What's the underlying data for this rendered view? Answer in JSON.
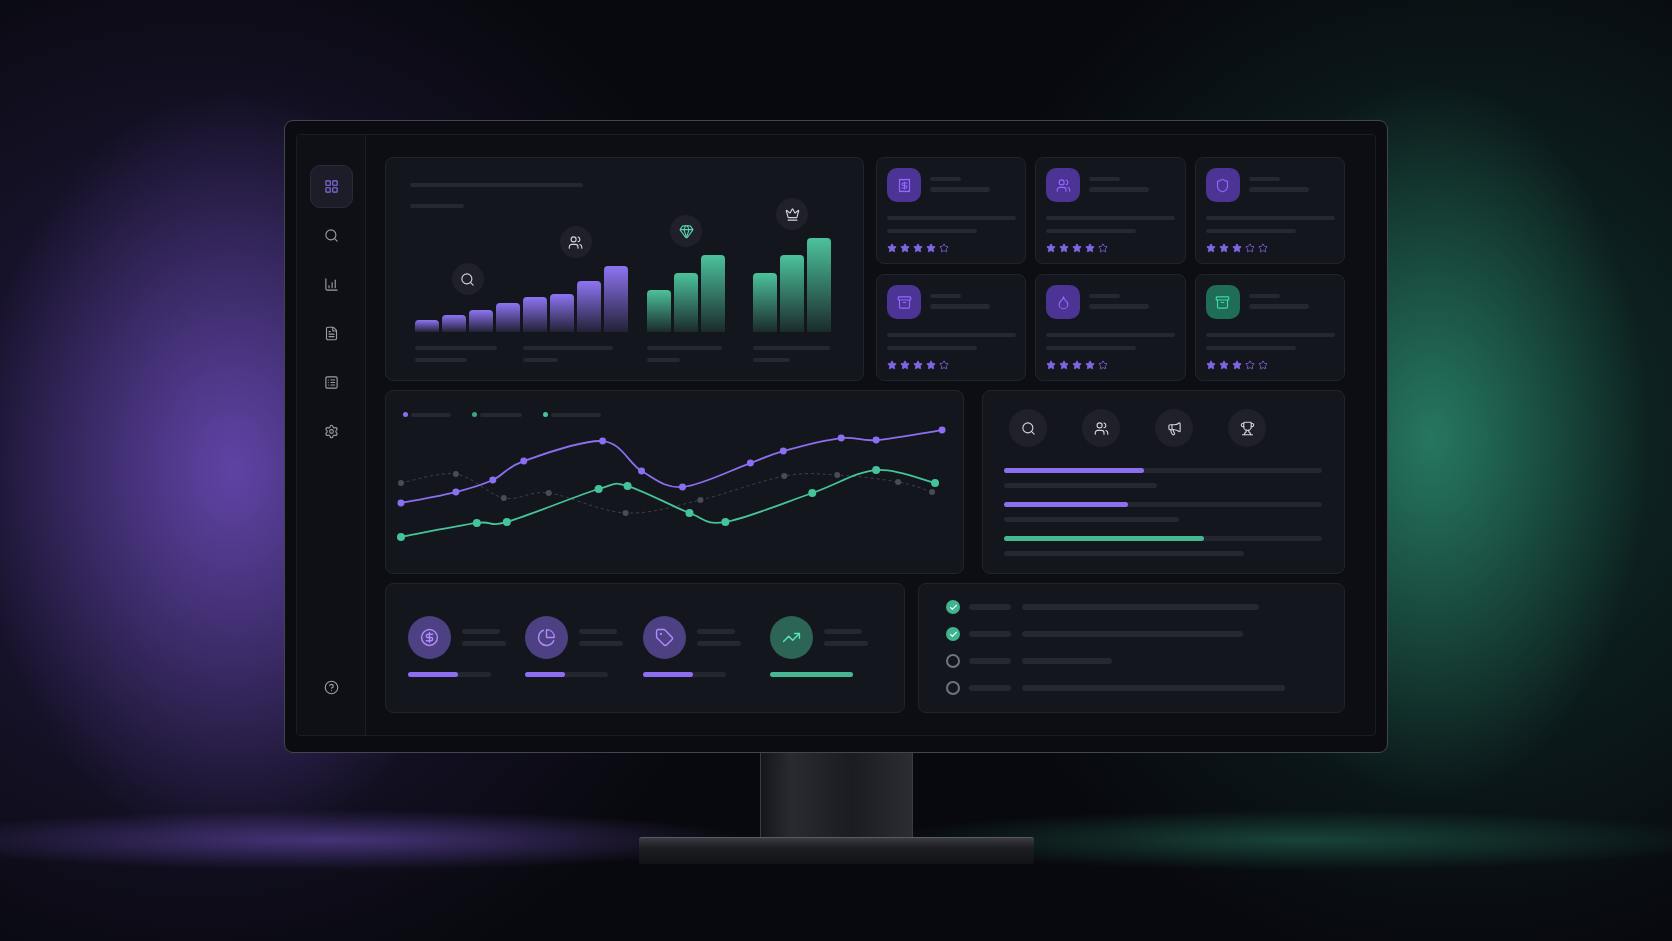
{
  "sidebar": {
    "items": [
      {
        "selected": true
      },
      {
        "selected": false
      },
      {
        "selected": false
      },
      {
        "selected": false
      },
      {
        "selected": false
      },
      {
        "selected": false
      }
    ]
  },
  "cards": [
    {
      "color": "#4b3494",
      "stars": 4
    },
    {
      "color": "#4b3494",
      "stars": 4
    },
    {
      "color": "#4b3494",
      "stars": 3
    },
    {
      "color": "#4b3494",
      "stars": 4
    },
    {
      "color": "#4b3494",
      "stars": 4
    },
    {
      "color": "#1f6d56",
      "stars": 3
    }
  ],
  "line_chart": {
    "legend": [
      {
        "color": "#8c6ff0"
      },
      {
        "color": "#3aa882"
      },
      {
        "color": "#45c49a"
      }
    ]
  },
  "goals": [
    {
      "color": "#8c6ff0",
      "level": 0.44
    },
    {
      "color": "#8c6ff0",
      "level": 0.39
    },
    {
      "color": "#45b892",
      "level": 0.63
    }
  ],
  "stats": [
    {
      "color": "#8c6ff0",
      "level": 0.6
    },
    {
      "color": "#8c6ff0",
      "level": 0.48
    },
    {
      "color": "#8c6ff0",
      "level": 0.6
    },
    {
      "color": "#45b892",
      "level": 1
    }
  ],
  "tasks": [
    {
      "checked": true
    },
    {
      "checked": true
    },
    {
      "checked": false
    },
    {
      "checked": false
    }
  ]
}
